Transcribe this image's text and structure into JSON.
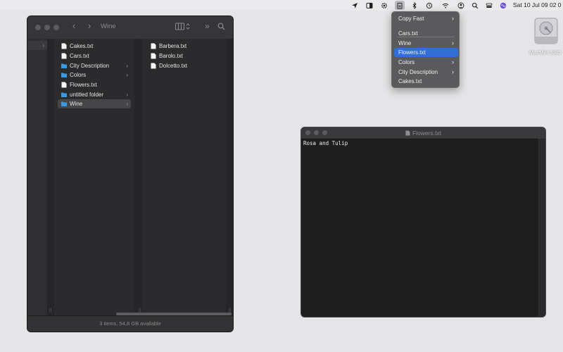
{
  "menubar": {
    "clock": "Sat 10 Jul  09 02 0",
    "icons": [
      "location-arrow-icon",
      "sidebar-app-icon",
      "gear-icon",
      "clipboard-menu-icon",
      "bluetooth-icon",
      "time-machine-icon",
      "wifi-icon",
      "user-icon",
      "search-icon",
      "control-center-icon",
      "siri-icon"
    ]
  },
  "dropdown": {
    "items": [
      {
        "label": "Copy Fast",
        "submenu": true
      },
      {
        "label": "Cars.txt",
        "submenu": false
      },
      {
        "label": "Wine",
        "submenu": true
      },
      {
        "label": "Flowers.txt",
        "submenu": false,
        "selected": true
      },
      {
        "label": "Colors",
        "submenu": true
      },
      {
        "label": "City Description",
        "submenu": true
      },
      {
        "label": "Cakes.txt",
        "submenu": false
      }
    ]
  },
  "desktop": {
    "disk_label": "MacMini SSD"
  },
  "finder": {
    "title": "Wine",
    "status": "3 items, 54,8 GB available",
    "column2": [
      {
        "label": "Cakes.txt",
        "type": "file"
      },
      {
        "label": "Cars.txt",
        "type": "file"
      },
      {
        "label": "City Description",
        "type": "folder"
      },
      {
        "label": "Colors",
        "type": "folder"
      },
      {
        "label": "Flowers.txt",
        "type": "file"
      },
      {
        "label": "untitled folder",
        "type": "folder"
      },
      {
        "label": "Wine",
        "type": "folder",
        "selected": true
      }
    ],
    "column3": [
      {
        "label": "Barbera.txt",
        "type": "file"
      },
      {
        "label": "Barolo.txt",
        "type": "file"
      },
      {
        "label": "Dolcetto.txt",
        "type": "file"
      }
    ]
  },
  "textedit": {
    "title": "Flowers.txt",
    "content": "Rosa and Tulip"
  },
  "colors": {
    "accent": "#2f6fd6",
    "folder": "#3b9ae1"
  }
}
